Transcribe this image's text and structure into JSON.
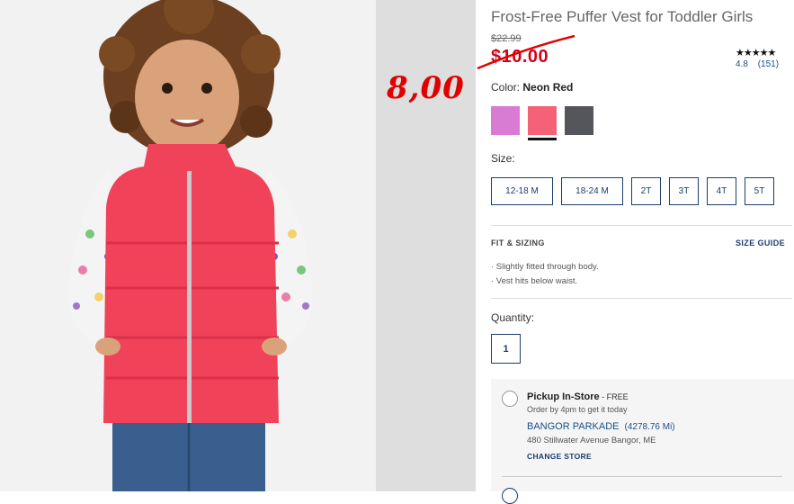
{
  "product": {
    "title": "Frost-Free Puffer Vest for Toddler Girls",
    "old_price": "$22.99",
    "sale_price": "$10.00",
    "handwritten_price": "8,00",
    "rating_stars": "★★★★★",
    "rating_value": "4.8",
    "rating_count": "(151)"
  },
  "color": {
    "label": "Color:",
    "selected": "Neon Red",
    "swatches": [
      {
        "name": "purple",
        "hex": "#d97bd3"
      },
      {
        "name": "neon-red",
        "hex": "#f56177",
        "selected": true
      },
      {
        "name": "gray",
        "hex": "#55555c"
      }
    ]
  },
  "size": {
    "label": "Size:",
    "options": [
      "12-18 M",
      "18-24 M",
      "2T",
      "3T",
      "4T",
      "5T"
    ]
  },
  "fit": {
    "heading": "FIT & SIZING",
    "size_guide": "SIZE GUIDE",
    "points": [
      "· Slightly fitted through body.",
      "· Vest hits below waist."
    ]
  },
  "quantity": {
    "label": "Quantity:",
    "value": "1"
  },
  "pickup": {
    "title": "Pickup In-Store",
    "free": " - FREE",
    "subtitle": "Order by 4pm to get it today",
    "store_name": "BANGOR PARKADE",
    "store_distance": "(4278.76 Mi)",
    "store_address": "480 Stillwater Avenue Bangor, ME",
    "change_store": "CHANGE STORE"
  },
  "colors": {
    "accent": "#1b3d6e",
    "sale": "#d0021b",
    "vest": "#f0435a"
  }
}
